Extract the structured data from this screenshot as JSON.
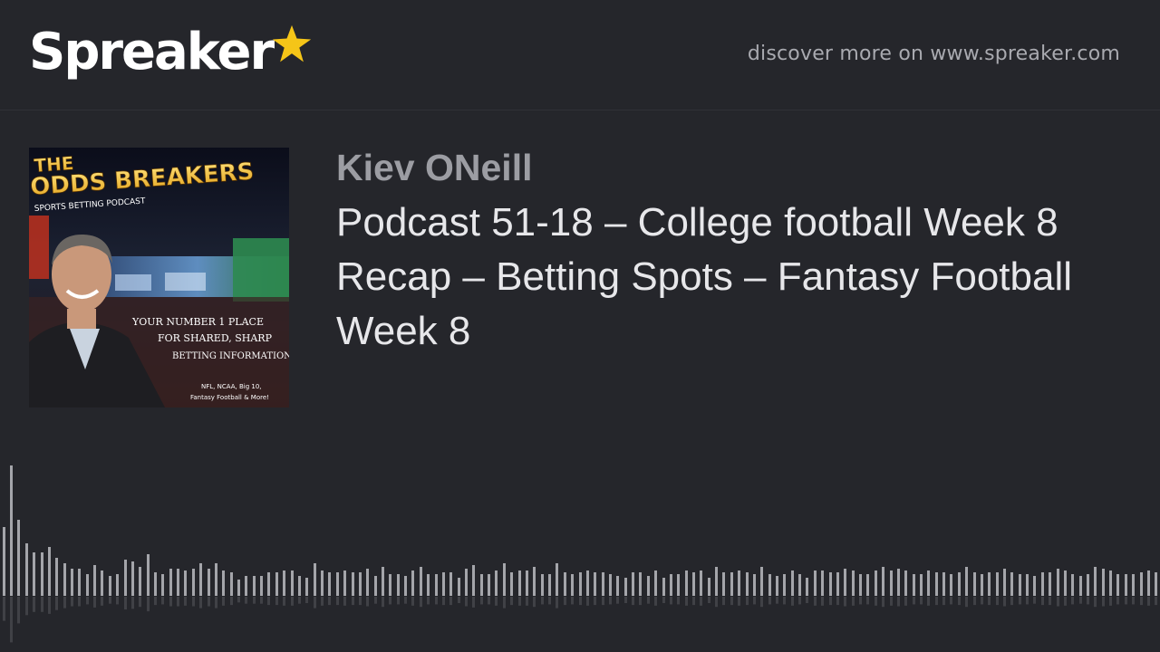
{
  "header": {
    "brand": "Spreaker",
    "brand_icon": "star-icon",
    "brand_accent": "#f5c518",
    "discover_text": "discover more on www.spreaker.com"
  },
  "cover": {
    "title_line1": "THE",
    "title_line2": "ODDS BREAKERS",
    "subtitle": "SPORTS BETTING PODCAST",
    "tagline_1": "YOUR NUMBER 1 PLACE",
    "tagline_2": "FOR SHARED, SHARP",
    "tagline_3": "BETTING INFORMATION",
    "footer_1": "NFL, NCAA, Big 10,",
    "footer_2": "Fantasy Football & More!"
  },
  "episode": {
    "author": "Kiev ONeill",
    "title": "Podcast 51-18 – College football Week 8 Recap – Betting Spots – Fantasy Football Week 8"
  },
  "waveform": {
    "bar_color": "#a4a5aa",
    "levels": [
      0.38,
      0.72,
      0.42,
      0.29,
      0.24,
      0.24,
      0.27,
      0.21,
      0.18,
      0.15,
      0.15,
      0.12,
      0.17,
      0.14,
      0.11,
      0.12,
      0.2,
      0.19,
      0.16,
      0.23,
      0.13,
      0.12,
      0.15,
      0.15,
      0.14,
      0.15,
      0.18,
      0.15,
      0.18,
      0.14,
      0.13,
      0.09,
      0.11,
      0.11,
      0.11,
      0.13,
      0.13,
      0.14,
      0.14,
      0.11,
      0.1,
      0.18,
      0.14,
      0.13,
      0.13,
      0.14,
      0.13,
      0.13,
      0.15,
      0.11,
      0.16,
      0.12,
      0.12,
      0.11,
      0.14,
      0.16,
      0.12,
      0.12,
      0.13,
      0.13,
      0.1,
      0.15,
      0.17,
      0.12,
      0.12,
      0.14,
      0.18,
      0.13,
      0.14,
      0.14,
      0.16,
      0.12,
      0.12,
      0.18,
      0.13,
      0.12,
      0.13,
      0.14,
      0.13,
      0.13,
      0.12,
      0.11,
      0.1,
      0.13,
      0.13,
      0.11,
      0.14,
      0.1,
      0.12,
      0.12,
      0.14,
      0.13,
      0.14,
      0.1,
      0.16,
      0.13,
      0.13,
      0.14,
      0.13,
      0.12,
      0.16,
      0.12,
      0.11,
      0.12,
      0.14,
      0.12,
      0.1,
      0.14,
      0.14,
      0.13,
      0.13,
      0.15,
      0.14,
      0.12,
      0.12,
      0.14,
      0.16,
      0.14,
      0.15,
      0.14,
      0.12,
      0.12,
      0.14,
      0.13,
      0.13,
      0.12,
      0.13,
      0.16,
      0.13,
      0.12,
      0.13,
      0.13,
      0.15,
      0.13,
      0.12,
      0.12,
      0.11,
      0.13,
      0.13,
      0.15,
      0.14,
      0.12,
      0.11,
      0.12,
      0.16,
      0.15,
      0.14,
      0.12,
      0.12,
      0.12,
      0.13,
      0.14,
      0.13
    ]
  }
}
